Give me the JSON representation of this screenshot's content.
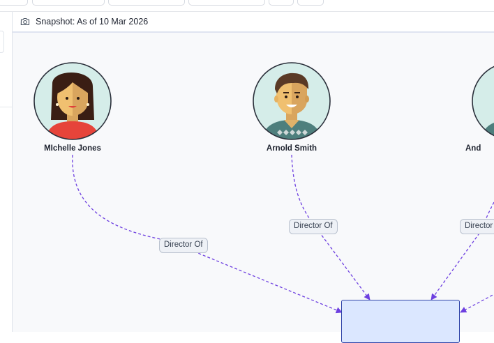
{
  "toolbar": {
    "buttons": [
      "",
      "",
      "",
      "",
      "",
      ""
    ]
  },
  "snapshot": {
    "icon": "camera-icon",
    "label": "Snapshot: As of 10 Mar 2026"
  },
  "graph": {
    "people": [
      {
        "name": "MIchelle Jones",
        "avatar": "woman-avatar"
      },
      {
        "name": "Arnold Smith",
        "avatar": "man-avatar"
      },
      {
        "name": "And",
        "avatar": "man-avatar"
      }
    ],
    "edges": [
      {
        "label": "Director Of"
      },
      {
        "label": "Director Of"
      },
      {
        "label": "Director"
      }
    ],
    "company": {
      "name": ""
    },
    "colors": {
      "edge": "#6d3fe0",
      "company_fill": "#dbe7ff",
      "company_border": "#2f44a8",
      "avatar_bg": "#d5ede9"
    }
  }
}
